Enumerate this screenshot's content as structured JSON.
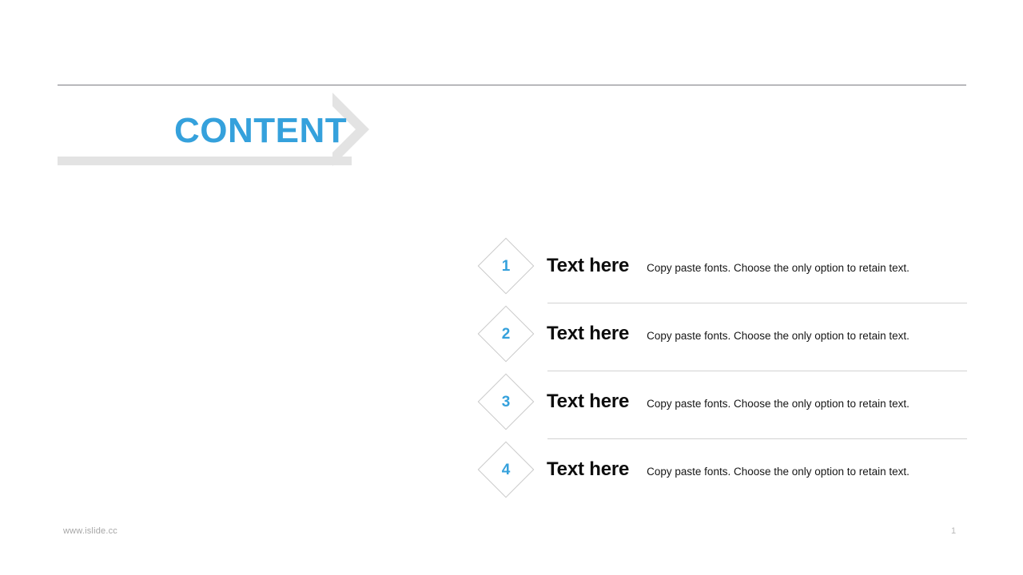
{
  "slide": {
    "title": "CONTENT",
    "accent_color": "#35a1dc",
    "rule_color": "#7b7b81",
    "bar_color": "#e3e3e3",
    "chevron_color": "#e3e3e3",
    "background": "#ffffff"
  },
  "content": {
    "items": [
      {
        "number": "1",
        "heading": "Text here",
        "description": "Copy paste fonts. Choose the only option to retain text."
      },
      {
        "number": "2",
        "heading": "Text here",
        "description": "Copy paste fonts. Choose the only option to retain text."
      },
      {
        "number": "3",
        "heading": "Text here",
        "description": "Copy paste fonts. Choose the only option to retain text."
      },
      {
        "number": "4",
        "heading": "Text here",
        "description": "Copy paste fonts. Choose the only option to retain text."
      }
    ]
  },
  "footer": {
    "url": "www.islide.cc",
    "page_number": "1"
  }
}
